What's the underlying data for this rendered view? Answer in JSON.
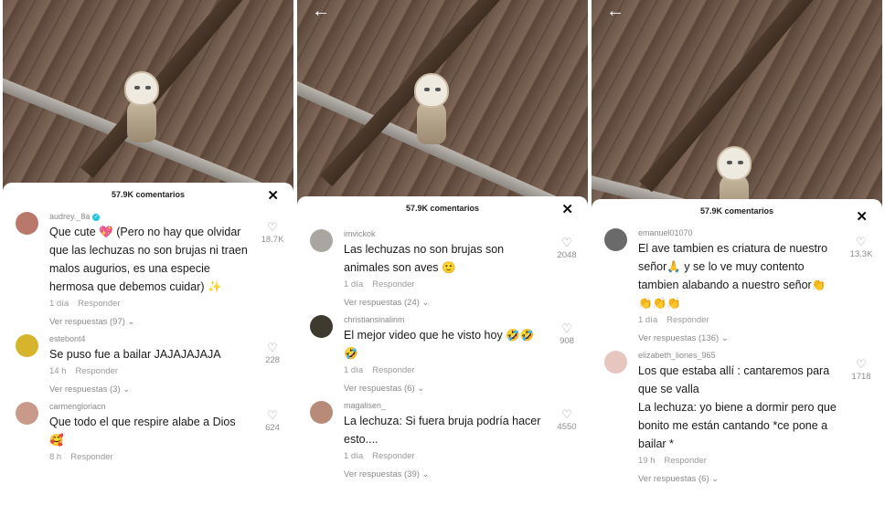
{
  "panels": [
    {
      "header": {
        "title": "57.9K comentarios",
        "close_icon": "✕"
      },
      "comments": [
        {
          "user": "audrey._8a",
          "verified": true,
          "text": "Que cute 💖 (Pero no hay que olvidar que las lechuzas no son brujas ni traen malos augurios, es una especie hermosa que debemos cuidar) ✨",
          "time": "1 día",
          "reply": "Responder",
          "view_replies": "Ver respuestas (97)",
          "likes": "18.7K",
          "avatar_color": "#b9786a"
        },
        {
          "user": "estebont4",
          "verified": false,
          "text": "Se puso fue a bailar JAJAJAJAJA",
          "time": "14 h",
          "reply": "Responder",
          "view_replies": "Ver respuestas (3)",
          "likes": "228",
          "avatar_color": "#d6b52c"
        },
        {
          "user": "carmengloriacn",
          "verified": false,
          "text": "Que todo el que respire alabe a Dios 🥰",
          "time": "8 h",
          "reply": "Responder",
          "view_replies": "",
          "likes": "624",
          "avatar_color": "#c99a8a"
        }
      ]
    },
    {
      "header": {
        "title": "57.9K comentarios",
        "close_icon": "✕"
      },
      "back_icon": "←",
      "comments": [
        {
          "user": "imvickok",
          "verified": false,
          "text": "Las lechuzas no son brujas son animales son aves 🙂",
          "time": "1 día",
          "reply": "Responder",
          "view_replies": "Ver respuestas (24)",
          "likes": "2048",
          "avatar_color": "#a9a5a0"
        },
        {
          "user": "christiansinalinm",
          "verified": false,
          "text": "El mejor video que he visto hoy 🤣🤣🤣",
          "time": "1 día",
          "reply": "Responder",
          "view_replies": "Ver respuestas (6)",
          "likes": "908",
          "avatar_color": "#3e3a30"
        },
        {
          "user": "magalisen_",
          "verified": false,
          "text": "La lechuza: Si fuera bruja podría hacer esto....",
          "time": "1 día",
          "reply": "Responder",
          "view_replies": "Ver respuestas (39)",
          "likes": "4550",
          "avatar_color": "#b88a78"
        }
      ]
    },
    {
      "header": {
        "title": "57.9K comentarios",
        "close_icon": "✕"
      },
      "back_icon": "←",
      "comments": [
        {
          "user": "emanuel01070",
          "verified": false,
          "text": "El ave tambien es criatura de nuestro señor🙏 y se lo ve muy contento tambien alabando a nuestro señor👏 👏👏👏",
          "time": "1 día",
          "reply": "Responder",
          "view_replies": "Ver respuestas (136)",
          "likes": "13.3K",
          "avatar_color": "#6a6a6a"
        },
        {
          "user": "elizabeth_liones_965",
          "verified": false,
          "text": "Los que estaba allí : cantaremos para que se valla\nLa lechuza: yo biene a dormir pero que bonito me están cantando *ce pone a bailar *",
          "time": "19 h",
          "reply": "Responder",
          "view_replies": "Ver respuestas (6)",
          "likes": "1718",
          "avatar_color": "#e7c6bf"
        }
      ]
    }
  ],
  "icons": {
    "like": "heart-outline-icon",
    "chevron": "chevron-down-icon"
  }
}
